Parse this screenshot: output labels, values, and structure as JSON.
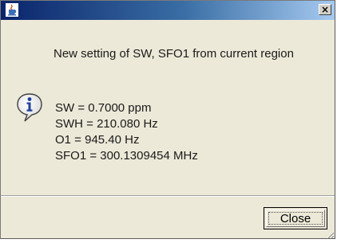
{
  "titlebar": {
    "app_icon": "java-cup-icon",
    "close_glyph": "×"
  },
  "message": {
    "icon": "info-icon",
    "heading": "New setting of SW, SFO1 from current region",
    "lines": [
      "SW = 0.7000 ppm",
      "SWH = 210.080 Hz",
      "O1 = 945.40 Hz",
      "SFO1 = 300.1309454 MHz"
    ]
  },
  "buttons": {
    "close_label": "Close"
  },
  "colors": {
    "title_start": "#0a246a",
    "title_end": "#a6caf0",
    "dialog_bg": "#ece9d8"
  }
}
